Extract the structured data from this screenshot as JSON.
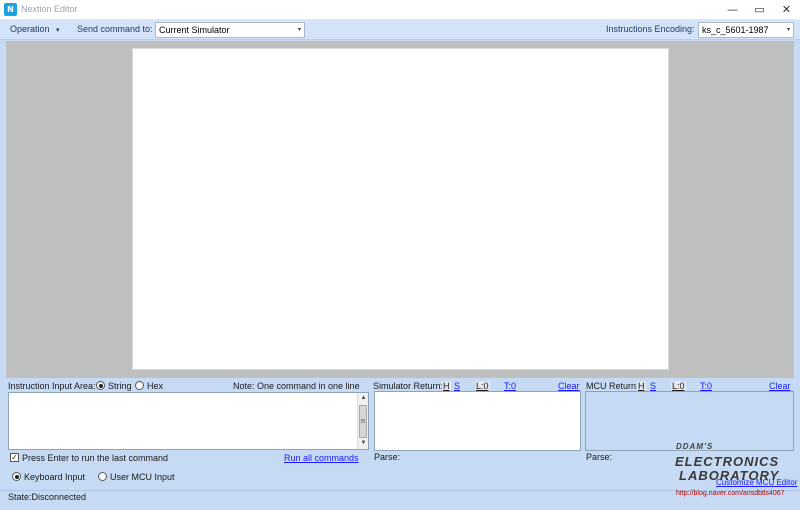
{
  "window": {
    "title": "Nextion Editor",
    "app_icon": "nextion-logo-icon",
    "controls": {
      "minimize": "—",
      "maximize": "▭",
      "close": "✕"
    }
  },
  "toolbar": {
    "operation_label": "Operation",
    "operation_caret": "▾",
    "send_command_label": "Send command to:",
    "send_command_value": "Current Simulator",
    "encoding_label": "Instructions Encoding:",
    "encoding_value": "ks_c_5601-1987",
    "select_caret": "▾"
  },
  "input_area": {
    "label": "Instruction Input Area:",
    "mode_string": "String",
    "mode_hex": "Hex",
    "selected_mode": "String",
    "note": "Note: One command in one line",
    "text": "",
    "press_enter_label": "Press Enter to run the last command",
    "press_enter_checked": true,
    "check_mark": "✓",
    "run_all_link": "Run all commands",
    "input_keyboard": "Keyboard Input",
    "input_user_mcu": "User MCU Input",
    "selected_input": "Keyboard Input",
    "scroll_up": "▲",
    "scroll_down": "▼"
  },
  "simulator_return": {
    "label": "Simulator Return:",
    "h": "H",
    "s": "S",
    "l_count": "L:0",
    "t_count": "T:0",
    "clear": "Clear",
    "parse_label": "Parse:"
  },
  "mcu_return": {
    "label": "MCU Return:",
    "h": "H",
    "s": "S",
    "l_count": "L:0",
    "t_count": "T:0",
    "clear": "Clear",
    "parse_label": "Parse:",
    "link_partial": "Customize MCU Editor"
  },
  "status": {
    "state": "State:Disconnected"
  },
  "watermark": {
    "line1": "DDAM'S",
    "line2": "ELECTRONICS",
    "line3": "LABORATORY",
    "url": "http://blog.naver.com/ansdbtls4067"
  },
  "colors": {
    "toolbar_bg": "#d4e3f7",
    "panel_bg": "#c6daf3",
    "canvas_bg": "#bfbfbf",
    "link": "#1a1aff",
    "watermark_url": "#c00000"
  }
}
